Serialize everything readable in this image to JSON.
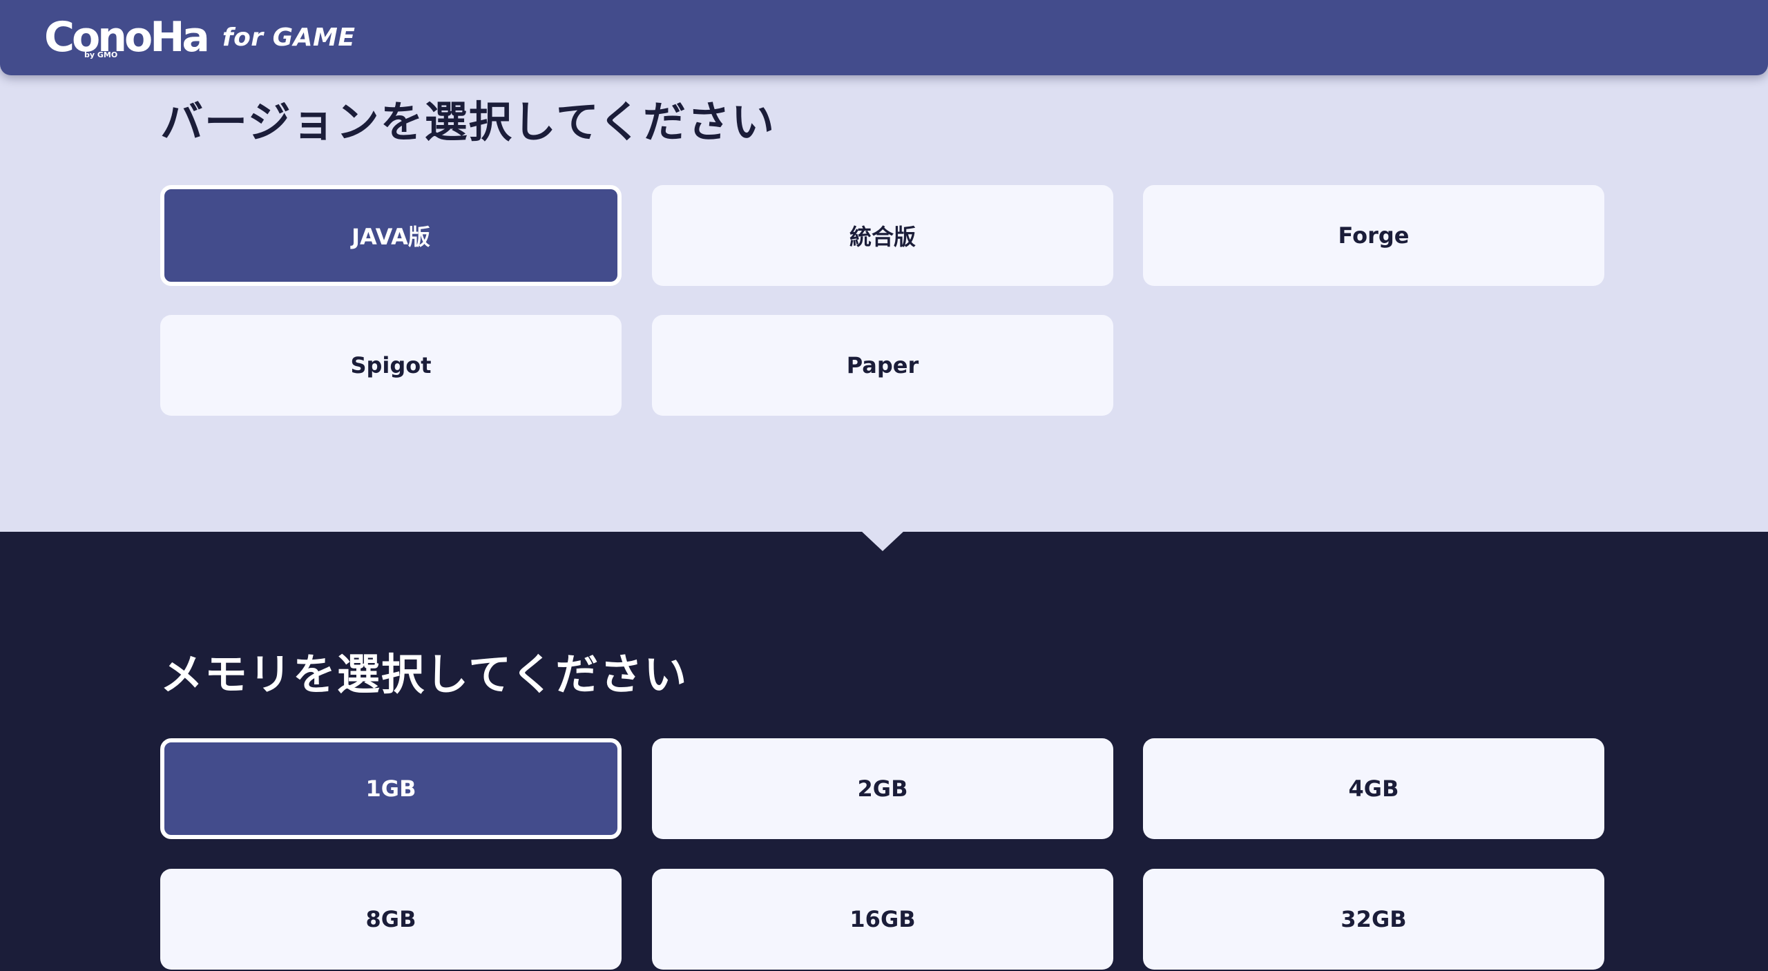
{
  "brand": {
    "logo_text": "ConoHa",
    "logo_sub": "by GMO",
    "product": "for GAME"
  },
  "version_section": {
    "title": "バージョンを選択してください",
    "options": [
      {
        "label": "JAVA版",
        "selected": true
      },
      {
        "label": "統合版",
        "selected": false
      },
      {
        "label": "Forge",
        "selected": false
      },
      {
        "label": "Spigot",
        "selected": false
      },
      {
        "label": "Paper",
        "selected": false
      }
    ]
  },
  "memory_section": {
    "title": "メモリを選択してください",
    "options": [
      {
        "label": "1GB",
        "selected": true
      },
      {
        "label": "2GB",
        "selected": false
      },
      {
        "label": "4GB",
        "selected": false
      },
      {
        "label": "8GB",
        "selected": false
      },
      {
        "label": "16GB",
        "selected": false
      },
      {
        "label": "32GB",
        "selected": false
      }
    ]
  },
  "colors": {
    "accent": "#434c8c",
    "light_bg": "#dddff2",
    "dark_bg": "#1b1d39",
    "card_bg": "#f5f6fe"
  }
}
